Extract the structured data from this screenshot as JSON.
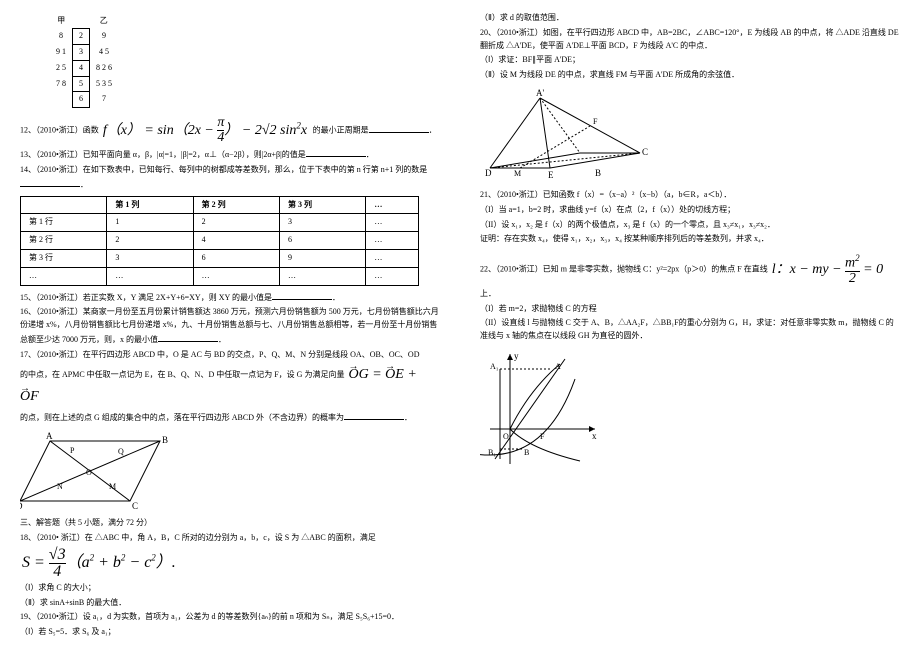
{
  "mini_table": {
    "header": [
      "甲",
      "",
      "乙"
    ],
    "rows": [
      [
        "8",
        "2",
        "9"
      ],
      [
        "9",
        "1",
        "3",
        "4",
        "5"
      ],
      [
        "2",
        "5",
        "4",
        "8",
        "2",
        "6"
      ],
      [
        "7",
        "8",
        "5",
        "5",
        "3",
        "5"
      ],
      [
        "",
        "6",
        "",
        "7",
        ""
      ]
    ]
  },
  "q12": {
    "pre": "12、（2010•浙江）函数",
    "formula": "f（x） = sin（2x − π/4） − 2√2 sin² x",
    "post": "的最小正周期是"
  },
  "q13": "13、（2010•浙江）已知平面向量 α，β，|α|=1，|β|=2，α⊥（α−2β），则|2α+β|的值是",
  "q14": "14、（2010•浙江）在如下数表中，已知每行、每列中的树都成等差数列，那么，位于下表中的第 n 行第 n+1 列的数是",
  "big_table": {
    "head": [
      "",
      "第 1 列",
      "第 2 列",
      "第 3 列",
      "…"
    ],
    "rows": [
      [
        "第 1 行",
        "1",
        "2",
        "3",
        "…"
      ],
      [
        "第 2 行",
        "2",
        "4",
        "6",
        "…"
      ],
      [
        "第 3 行",
        "3",
        "6",
        "9",
        "…"
      ],
      [
        "…",
        "…",
        "…",
        "…",
        "…"
      ]
    ]
  },
  "q15": "15、（2010•浙江）若正实数 X，Y 满足 2X+Y+6=XY，则 XY 的最小值是",
  "q16": "16、（2010•浙江）某商家一月份至五月份累计销售额达 3860 万元，预测六月份销售额为 500 万元，七月份销售额比六月份递增 x%，八月份销售额比七月份递增 x%，九、十月份销售总额与七、八月份销售总额相等，若一月份至十月份销售总额至少达 7000 万元，则，x 的最小值",
  "q17": "17、（2010•浙江）在平行四边形 ABCD 中，O 是 AC 与 BD 的交点，P、Q、M、N 分别是线段 OA、OB、OC、OD",
  "q17b_pre": "的中点，在 APMC 中任取一点记为 E，在 B、Q、N、D 中任取一点记为 F，设 G 为满足向量",
  "q17b_formula": "OG = OE + OF",
  "q17c": "的点，则在上述的点 G 组成的集合中的点，落在平行四边形 ABCD 外（不含边界）的概率为",
  "section3": "三、解答题（共 5 小题，满分 72 分）",
  "q18": "18、（2010• 浙江）在 △ABC 中，角 A，B，C 所对的边分别为 a，b，c，设 S 为 △ABC 的面积，满足",
  "q18_formula": "S = (√3/4)（a² + b² − c²）.",
  "q18_1": "（Ⅰ）求角 C 的大小；",
  "q18_2": "（Ⅱ）求 sinA+sinB 的最大值．",
  "q19": "19、（2010•浙江）设 a₁，d 为实数，首项为 a₁，公差为 d 的等差数列{aₙ}的前 n 项和为 Sₙ，满足 S₅S₆+15=0．",
  "q19_1": "（Ⅰ）若 S₅=5．求 S₆ 及 a₁；",
  "q19_2r": "（Ⅱ）求 d 的取值范围．",
  "q20": "20、（2010•浙江）如图，在平行四边形 ABCD 中，AB=2BC，∠ABC=120°，E 为线段 AB 的中点，将 △ADE 沿直线 DE 翻折成 △A'DE，使平面 A'DE⊥平面 BCD，F 为线段 A'C 的中点．",
  "q20_1": "（Ⅰ）求证：BF∥平面 A'DE；",
  "q20_2": "（Ⅱ）设 M 为线段 DE 的中点，求直线 FM 与平面 A'DE 所成角的余弦值．",
  "q21": "21、（2010•浙江）已知函数 f（x）=（x−a）²（x−b）（a，b∈R，a＜b）．",
  "q21_1": "（I）当 a=1，b=2 时，求曲线 y=f（x）在点（2，f（x））处的切线方程；",
  "q21_2": "（II）设 x₁，x₂ 是 f（x）的两个极值点，x₃ 是 f（x）的一个零点，且 x₃≠x₁，x₃≠x₂．",
  "q21_3": "证明：存在实数 x₄，使得 x₁，x₂，x₃，x₄ 按某种顺序排列后的等差数列，并求 x₄．",
  "q22_pre": "22、（2010•浙江）已知 m 是非零实数，抛物线 C：y²=2px（p＞0）的焦点 F 在直线",
  "q22_formula": "l：x − my − m²/2 = 0",
  "q22_post": "上．",
  "q22_1": "（I）若 m=2，求抛物线 C 的方程",
  "q22_2": "（II）设直线 l 与抛物线 C 交于 A、B，△AA₂F，△BB₁F的重心分别为 G，H，求证：对任意非零实数 m，抛物线 C 的准线与 x 轴的焦点在以线段 GH 为直径的圆外．",
  "diagram_labels": {
    "d1": {
      "A": "A",
      "B": "B",
      "C": "C",
      "D": "D",
      "P": "P",
      "Q": "Q",
      "M": "M",
      "N": "N",
      "O": "O"
    },
    "d2": {
      "A": "A'",
      "B": "B",
      "C": "C",
      "D": "D",
      "E": "E",
      "F": "F",
      "M": "M"
    },
    "d3": {
      "A": "A",
      "B": "B",
      "A1": "A₁",
      "B1": "B₁",
      "O": "O",
      "F": "F",
      "x": "x",
      "y": "y"
    }
  }
}
